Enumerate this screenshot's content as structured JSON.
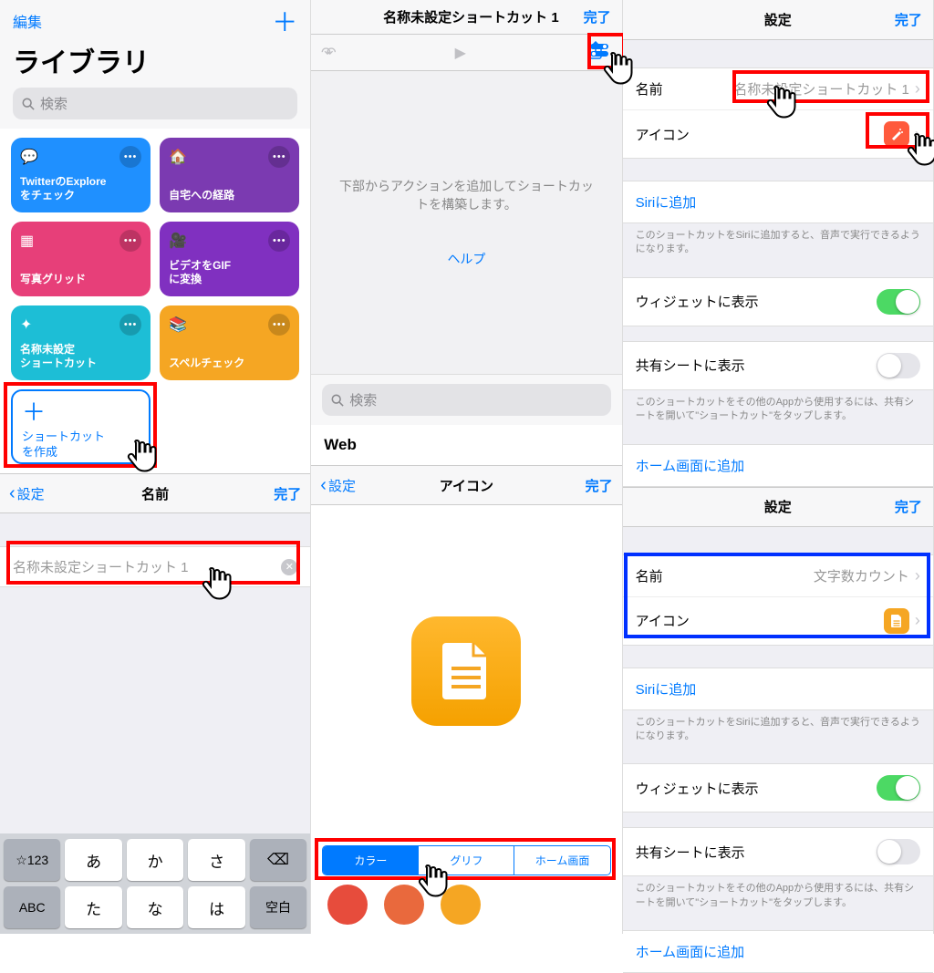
{
  "panel1": {
    "edit": "編集",
    "library_title": "ライブラリ",
    "search_placeholder": "検索",
    "tiles": [
      {
        "label": "TwitterのExplore\nをチェック",
        "color": "#1f90ff"
      },
      {
        "label": "自宅への経路",
        "color": "#7b3ab1"
      },
      {
        "label": "写真グリッド",
        "color": "#e73f79"
      },
      {
        "label": "ビデオをGIF\nに変換",
        "color": "#8030c0"
      },
      {
        "label": "名称未設定\nショートカット",
        "color": "#1dbed6"
      },
      {
        "label": "スペルチェック",
        "color": "#f5a623"
      }
    ],
    "create_label": "ショートカット\nを作成",
    "name_nav_back": "設定",
    "name_nav_title": "名前",
    "name_nav_done": "完了",
    "name_input": "名称未設定ショートカット 1",
    "kb_row1": [
      "☆123",
      "あ",
      "か",
      "さ",
      "⌫"
    ],
    "kb_row2": [
      "ABC",
      "た",
      "な",
      "は",
      "空白"
    ]
  },
  "panel2": {
    "title": "名称未設定ショートカット 1",
    "done": "完了",
    "body_text": "下部からアクションを追加してショートカットを構築します。",
    "help": "ヘルプ",
    "search_placeholder": "検索",
    "web_header": "Web",
    "icon_nav_back": "設定",
    "icon_nav_title": "アイコン",
    "icon_nav_done": "完了",
    "segments": [
      "カラー",
      "グリフ",
      "ホーム画面"
    ],
    "colors": [
      "#e74c3c",
      "#e9693d",
      "#f5a623"
    ]
  },
  "panel3a": {
    "title": "設定",
    "done": "完了",
    "name_label": "名前",
    "name_value": "名称未設定ショートカット 1",
    "icon_label": "アイコン",
    "siri_link": "Siriに追加",
    "siri_desc": "このショートカットをSiriに追加すると、音声で実行できるようになります。",
    "widget_label": "ウィジェットに表示",
    "share_label": "共有シートに表示",
    "share_desc": "このショートカットをその他のAppから使用するには、共有シートを開いて\"ショートカット\"をタップします。",
    "home_link": "ホーム画面に追加"
  },
  "panel3b": {
    "title": "設定",
    "done": "完了",
    "name_label": "名前",
    "name_value": "文字数カウント",
    "icon_label": "アイコン",
    "siri_link": "Siriに追加",
    "siri_desc": "このショートカットをSiriに追加すると、音声で実行できるようになります。",
    "widget_label": "ウィジェットに表示",
    "share_label": "共有シートに表示",
    "share_desc": "このショートカットをその他のAppから使用するには、共有シートを開いて\"ショートカット\"をタップします。",
    "home_link": "ホーム画面に追加"
  }
}
